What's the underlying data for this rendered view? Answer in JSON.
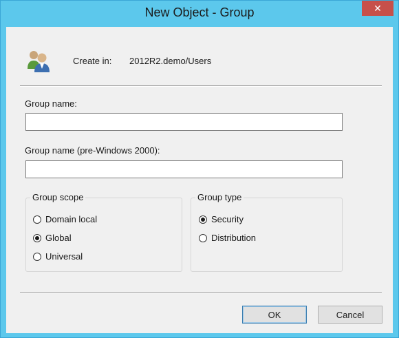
{
  "window": {
    "title": "New Object - Group",
    "close_glyph": "✕",
    "close_color": "#c7504a",
    "frame_color": "#5cc8ec"
  },
  "header": {
    "icon": "users-group-icon",
    "create_in_label": "Create in:",
    "create_in_value": "2012R2.demo/Users"
  },
  "fields": {
    "group_name_label": "Group name:",
    "group_name_value": "",
    "pre2000_label": "Group name (pre-Windows 2000):",
    "pre2000_value": ""
  },
  "group_scope": {
    "legend": "Group scope",
    "options": [
      {
        "label": "Domain local",
        "selected": false
      },
      {
        "label": "Global",
        "selected": true
      },
      {
        "label": "Universal",
        "selected": false
      }
    ]
  },
  "group_type": {
    "legend": "Group type",
    "options": [
      {
        "label": "Security",
        "selected": true
      },
      {
        "label": "Distribution",
        "selected": false
      }
    ]
  },
  "buttons": {
    "ok": "OK",
    "cancel": "Cancel"
  }
}
